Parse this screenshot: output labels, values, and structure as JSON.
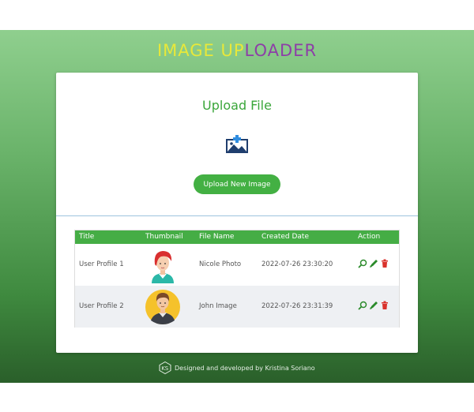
{
  "header": {
    "title_part1": "IMAGE ",
    "title_part2": "UP",
    "title_part3": "LOADER"
  },
  "upload": {
    "heading": "Upload File",
    "icon": "add-image-icon",
    "button_label": "Upload New Image"
  },
  "table": {
    "columns": [
      "Title",
      "Thumbnail",
      "File Name",
      "Created Date",
      "Action"
    ],
    "rows": [
      {
        "title": "User Profile 1",
        "thumbnail": "female-avatar",
        "file_name": "Nicole Photo",
        "created_date": "2022-07-26 23:30:20"
      },
      {
        "title": "User Profile 2",
        "thumbnail": "male-avatar",
        "file_name": "John Image",
        "created_date": "2022-07-26 23:31:39"
      }
    ],
    "actions": [
      "view-icon",
      "edit-icon",
      "delete-icon"
    ]
  },
  "footer": {
    "text": "Designed and developed by Kristina Soriano",
    "logo": "ks-logo"
  },
  "colors": {
    "accent_green": "#43b043",
    "title_yellow": "#e8e83a",
    "title_purple": "#8d3fa7",
    "delete_red": "#d9322c"
  }
}
